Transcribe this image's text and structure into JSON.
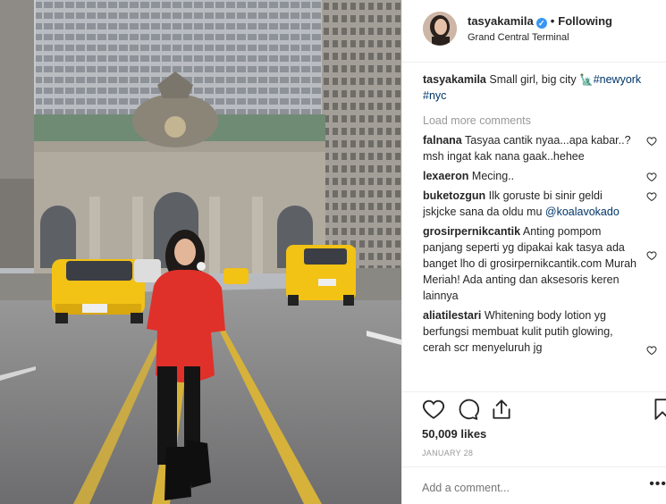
{
  "post": {
    "username": "tasyakamila",
    "follow_status": "Following",
    "separator": "•",
    "location": "Grand Central Terminal",
    "verified_glyph": "✓"
  },
  "caption": {
    "username": "tasyakamila",
    "text": "Small girl, big city",
    "emoji": "🗽",
    "hashtags": [
      "#newyork",
      "#nyc"
    ]
  },
  "load_more_label": "Load more comments",
  "comments": [
    {
      "username": "falnana",
      "text": "Tasyaa cantik nyaa...apa kabar..? msh ingat kak nana gaak..hehee"
    },
    {
      "username": "lexaeron",
      "text": "Mecing.."
    },
    {
      "username": "buketozgun",
      "text": "Ilk goruste bi sinir geldi jskjcke sana da oldu mu",
      "mention": "@koalavokado"
    },
    {
      "username": "grosirpernikcantik",
      "text": "Anting pompom panjang seperti yg dipakai kak tasya ada banget lho di grosirpernikcantik.com Murah Meriah! Ada anting dan aksesoris keren lainnya"
    },
    {
      "username": "aliatilestari",
      "text": "Whitening body lotion yg berfungsi membuat kulit putih glowing, cerah scr menyeluruh jg"
    }
  ],
  "likes": "50,009 likes",
  "date": "JANUARY 28",
  "add_comment_placeholder": "Add a comment...",
  "more_glyph": "•••",
  "icons": [
    "heart-icon",
    "comment-icon",
    "share-icon",
    "bookmark-icon",
    "verified-badge-icon",
    "more-options-icon"
  ],
  "colors": {
    "link": "#003569",
    "verified": "#3897f0",
    "muted": "#999999",
    "text": "#262626",
    "taxi": "#f2c215",
    "sweater": "#e0302a"
  }
}
